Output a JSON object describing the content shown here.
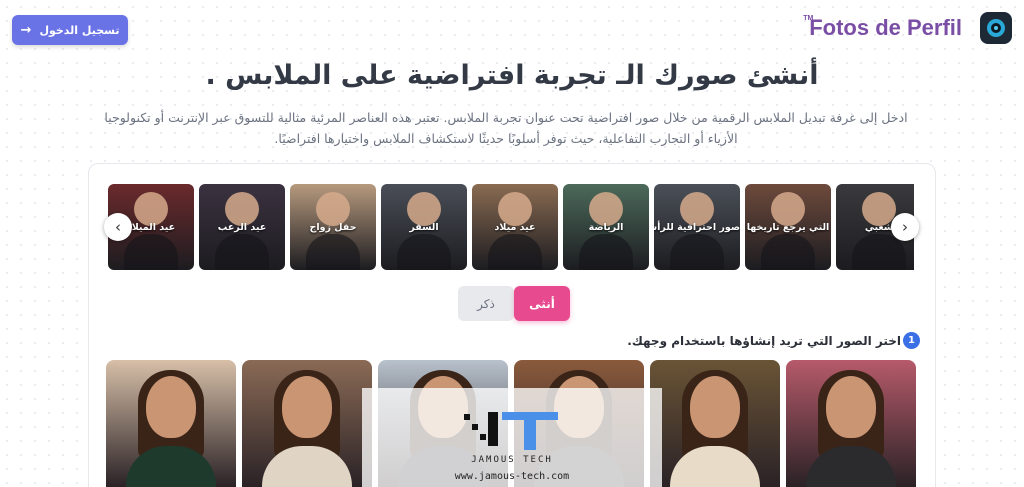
{
  "header": {
    "login_label": "تسجيل الدخول",
    "brand_name": "Fotos de Perfil",
    "brand_mark": "TM"
  },
  "hero": {
    "title": "أنشئ صورك الـ تجربة افتراضية على الملابس .",
    "description": "ادخل إلى غرفة تبديل الملابس الرقمية من خلال صور افتراضية تحت عنوان تجربة الملابس. تعتبر هذه العناصر المرئية مثالية للتسوق عبر الإنترنت أو تكنولوجيا الأزياء أو التجارب التفاعلية، حيث توفر أسلوبًا حديثًا لاستكشاف الملابس واختيارها افتراضيًا."
  },
  "categories": [
    {
      "label": "شعبي",
      "color": "#3a3a3d"
    },
    {
      "label": "التي يرجع تاريخها",
      "color": "#6e4a3c"
    },
    {
      "label": "صور احترافية للرأس",
      "color": "#4b5058"
    },
    {
      "label": "الرياضة",
      "color": "#4c6a5a"
    },
    {
      "label": "عيد ميلاد",
      "color": "#8a6b52"
    },
    {
      "label": "السفر",
      "color": "#4a4e57"
    },
    {
      "label": "حفل زواج",
      "color": "#b79a7e"
    },
    {
      "label": "عيد الرعب",
      "color": "#3b3240"
    },
    {
      "label": "عيد الميلاد",
      "color": "#6b2a2c"
    }
  ],
  "gender": {
    "female": "أنثى",
    "male": "ذكر",
    "selected": "female"
  },
  "step": {
    "number": "1",
    "text": "اختر الصور التي تريد إنشاؤها باستخدام وجهك."
  },
  "photos": [
    {
      "name": "photo-gym",
      "bg": "#b65a6a",
      "torso": "#2b2b2e"
    },
    {
      "name": "photo-mirror",
      "bg": "#6a5436",
      "torso": "#e8dcc8"
    },
    {
      "name": "photo-city",
      "bg": "#8a5a3c",
      "torso": "#3a3a3e"
    },
    {
      "name": "photo-office",
      "bg": "#b8c2cc",
      "torso": "#2e3138"
    },
    {
      "name": "photo-portrait",
      "bg": "#8a6a55",
      "torso": "#e0d4c4"
    },
    {
      "name": "photo-sombrero",
      "bg": "#d7bfa8",
      "torso": "#1e3a2c"
    }
  ],
  "watermark": {
    "name": "JAMOUS TECH",
    "url": "www.jamous-tech.com"
  },
  "colors": {
    "accent": "#6a73e6",
    "pink": "#e84a8f",
    "step_blue": "#3b6fe6"
  }
}
